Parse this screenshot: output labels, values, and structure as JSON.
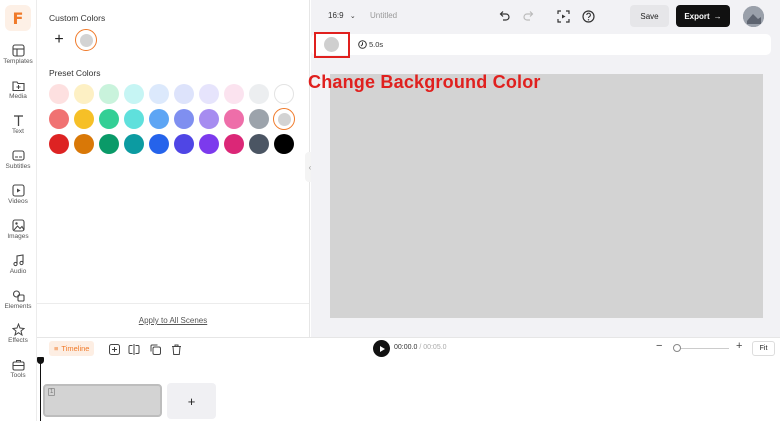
{
  "sidebar": {
    "logo_letter": "F",
    "items": [
      {
        "label": "Templates",
        "icon": "templates-icon"
      },
      {
        "label": "Media",
        "icon": "media-icon"
      },
      {
        "label": "Text",
        "icon": "text-icon"
      },
      {
        "label": "Subtitles",
        "icon": "subtitles-icon"
      },
      {
        "label": "Videos",
        "icon": "videos-icon"
      },
      {
        "label": "Images",
        "icon": "images-icon"
      },
      {
        "label": "Audio",
        "icon": "audio-icon"
      },
      {
        "label": "Elements",
        "icon": "elements-icon"
      },
      {
        "label": "Effects",
        "icon": "effects-icon"
      },
      {
        "label": "Tools",
        "icon": "tools-icon"
      }
    ]
  },
  "color_panel": {
    "custom_title": "Custom Colors",
    "add_symbol": "+",
    "custom_selected_color": "#d3d3d3",
    "preset_title": "Preset Colors",
    "preset_rows": [
      [
        "#fde0e0",
        "#fdf0c4",
        "#c9f3dc",
        "#c6f5f4",
        "#dce9fc",
        "#dde3fb",
        "#e6e4fc",
        "#fbe3ef",
        "#eceef0",
        "#ffffff"
      ],
      [
        "#f07272",
        "#f6c027",
        "#33cf95",
        "#5fe0dc",
        "#5da5f4",
        "#7f8ff0",
        "#a68cf0",
        "#ee6ea9",
        "#9ca3ab",
        "#d3d3d3"
      ],
      [
        "#dd2323",
        "#d97807",
        "#0a9a68",
        "#0c9ba1",
        "#2563eb",
        "#4f46e5",
        "#7c3aed",
        "#db2777",
        "#4b5563",
        "#000000"
      ]
    ],
    "selected_preset": "#d3d3d3",
    "apply_label": "Apply to All Scenes"
  },
  "topbar": {
    "ratio": "16:9",
    "project_title": "Untitled",
    "save_label": "Save",
    "export_label": "Export"
  },
  "scene": {
    "background_color": "#d3d3d3",
    "duration": "5.0s"
  },
  "annotation": {
    "text": "Change Background Color",
    "color": "#e0201e"
  },
  "timeline": {
    "tab_label": "Timeline",
    "current_time": "00:00.0",
    "total_time": "00:05.0",
    "fit_label": "Fit",
    "clip_number": "1",
    "add_scene_symbol": "+"
  },
  "colors": {
    "accent": "#f07a2a",
    "canvas_bg": "#d3d3d3"
  }
}
